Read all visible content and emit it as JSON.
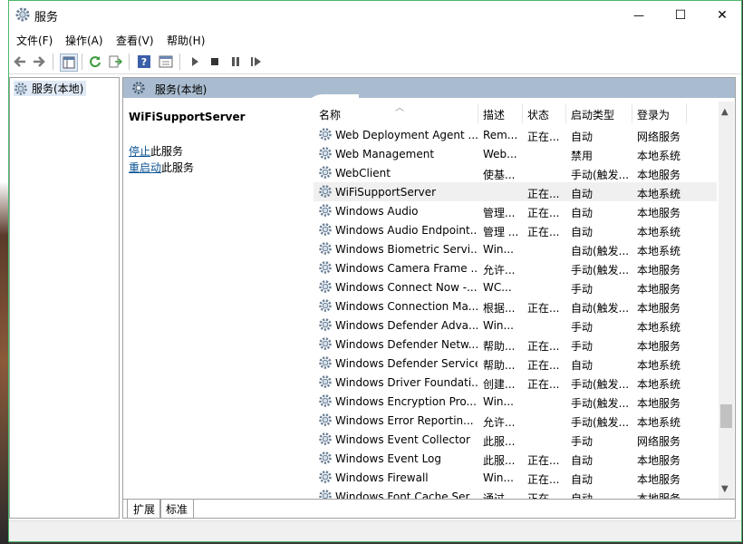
{
  "window": {
    "title": "服务"
  },
  "controls": {
    "minimize": "—",
    "maximize": "☐",
    "close": "✕"
  },
  "menu": [
    "文件(F)",
    "操作(A)",
    "查看(V)",
    "帮助(H)"
  ],
  "tree": {
    "item": "服务(本地)"
  },
  "panel": {
    "header": "服务(本地)"
  },
  "detail": {
    "service_name": "WiFiSupportServer",
    "stop_link": "停止",
    "stop_suffix": "此服务",
    "restart_link": "重启动",
    "restart_suffix": "此服务"
  },
  "columns": {
    "name": "名称",
    "desc": "描述",
    "status": "状态",
    "startup": "启动类型",
    "logon": "登录为"
  },
  "rows": [
    {
      "name": "Web Deployment Agent ...",
      "desc": "Rem...",
      "status": "正在...",
      "startup": "自动",
      "logon": "网络服务"
    },
    {
      "name": "Web Management",
      "desc": "Web...",
      "status": "",
      "startup": "禁用",
      "logon": "本地系统"
    },
    {
      "name": "WebClient",
      "desc": "使基...",
      "status": "",
      "startup": "手动(触发...",
      "logon": "本地服务"
    },
    {
      "name": "WiFiSupportServer",
      "desc": "",
      "status": "正在...",
      "startup": "自动",
      "logon": "本地系统"
    },
    {
      "name": "Windows Audio",
      "desc": "管理...",
      "status": "正在...",
      "startup": "自动",
      "logon": "本地服务"
    },
    {
      "name": "Windows Audio Endpoint...",
      "desc": "管理 ...",
      "status": "正在...",
      "startup": "自动",
      "logon": "本地系统"
    },
    {
      "name": "Windows Biometric Servi...",
      "desc": "Win...",
      "status": "",
      "startup": "自动(触发...",
      "logon": "本地系统"
    },
    {
      "name": "Windows Camera Frame ...",
      "desc": "允许...",
      "status": "",
      "startup": "手动(触发...",
      "logon": "本地服务"
    },
    {
      "name": "Windows Connect Now -...",
      "desc": "WC...",
      "status": "",
      "startup": "手动",
      "logon": "本地服务"
    },
    {
      "name": "Windows Connection Ma...",
      "desc": "根据...",
      "status": "正在...",
      "startup": "自动(触发...",
      "logon": "本地服务"
    },
    {
      "name": "Windows Defender Adva...",
      "desc": "Win...",
      "status": "",
      "startup": "手动",
      "logon": "本地系统"
    },
    {
      "name": "Windows Defender Netw...",
      "desc": "帮助...",
      "status": "正在...",
      "startup": "手动",
      "logon": "本地服务"
    },
    {
      "name": "Windows Defender Service",
      "desc": "帮助...",
      "status": "正在...",
      "startup": "自动",
      "logon": "本地系统"
    },
    {
      "name": "Windows Driver Foundati...",
      "desc": "创建...",
      "status": "正在...",
      "startup": "手动(触发...",
      "logon": "本地系统"
    },
    {
      "name": "Windows Encryption Pro...",
      "desc": "Win...",
      "status": "",
      "startup": "手动(触发...",
      "logon": "本地服务"
    },
    {
      "name": "Windows Error Reportin...",
      "desc": "允许...",
      "status": "",
      "startup": "手动(触发...",
      "logon": "本地系统"
    },
    {
      "name": "Windows Event Collector",
      "desc": "此服...",
      "status": "",
      "startup": "手动",
      "logon": "网络服务"
    },
    {
      "name": "Windows Event Log",
      "desc": "此服...",
      "status": "正在...",
      "startup": "自动",
      "logon": "本地服务"
    },
    {
      "name": "Windows Firewall",
      "desc": "Win...",
      "status": "正在...",
      "startup": "自动",
      "logon": "本地服务"
    },
    {
      "name": "Windows Font Cache Ser...",
      "desc": "通过...",
      "status": "正在...",
      "startup": "自动",
      "logon": "本地服务"
    }
  ],
  "tabs": [
    "扩展",
    "标准"
  ]
}
